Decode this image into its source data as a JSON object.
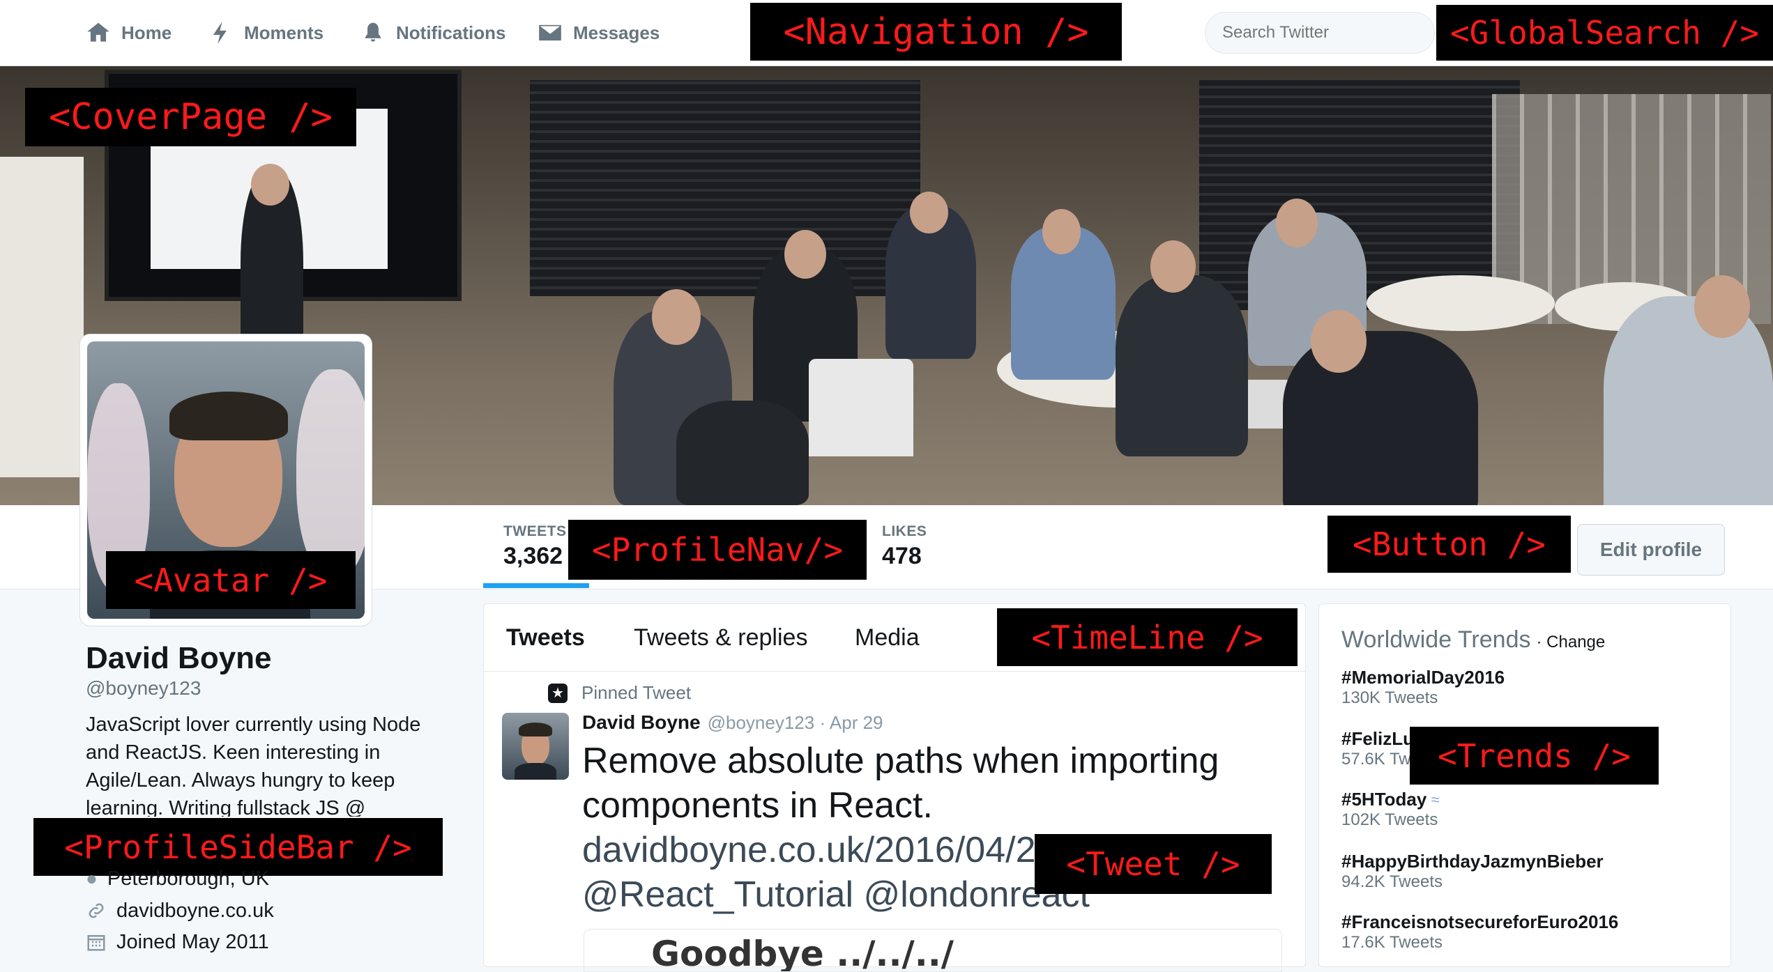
{
  "nav": {
    "items": [
      {
        "label": "Home",
        "icon": "home-icon"
      },
      {
        "label": "Moments",
        "icon": "lightning-icon"
      },
      {
        "label": "Notifications",
        "icon": "bell-icon"
      },
      {
        "label": "Messages",
        "icon": "envelope-icon"
      }
    ],
    "search_placeholder": "Search Twitter"
  },
  "annotations": {
    "navigation": "<Navigation />",
    "global_search": "<GlobalSearch />",
    "cover_page": "<CoverPage />",
    "avatar": "<Avatar />",
    "profile_nav": "<ProfileNav/>",
    "button": "<Button />",
    "timeline": "<TimeLine />",
    "trends": "<Trends />",
    "profile_sidebar": "<ProfileSideBar />",
    "tweet": "<Tweet />"
  },
  "profile": {
    "name": "David Boyne",
    "handle": "@boyney123",
    "bio": "JavaScript lover currently using Node and ReactJS. Keen interesting in Agile/Lean. Always hungry to keep learning. Writing fullstack JS @",
    "location": "Peterborough, UK",
    "website": "davidboyne.co.uk",
    "joined": "Joined May 2011"
  },
  "profile_nav": {
    "tweets_label": "TWEETS",
    "tweets_value": "3,362",
    "likes_label": "LIKES",
    "likes_value": "478",
    "edit_button": "Edit profile"
  },
  "timeline": {
    "tabs": [
      "Tweets",
      "Tweets & replies",
      "Media"
    ],
    "pinned_label": "Pinned Tweet",
    "tweet": {
      "author": "David Boyne",
      "meta": "@boyney123 · Apr 29",
      "text_line1": "Remove absolute paths when importing",
      "text_line2": "components in React.",
      "text_line3": "davidboyne.co.uk/2016/04/2",
      "text_line4": "@React_Tutorial @londonreact",
      "card_text": "Goodbye ../../../"
    }
  },
  "trends": {
    "title": "Worldwide Trends",
    "change": "· Change",
    "items": [
      {
        "tag": "#MemorialDay2016",
        "count": "130K Tweets"
      },
      {
        "tag": "#FelizLu",
        "count": "57.6K Tw"
      },
      {
        "tag": "#5HToday",
        "count": "102K Tweets"
      },
      {
        "tag": "#HappyBirthdayJazmynBieber",
        "count": "94.2K Tweets"
      },
      {
        "tag": "#FranceisnotsecureforEuro2016",
        "count": "17.6K Tweets"
      }
    ]
  },
  "colors": {
    "accent": "#1da1f2",
    "label_bg": "#000000",
    "label_text": "#ff1a1a",
    "nav_text": "#66757f"
  }
}
